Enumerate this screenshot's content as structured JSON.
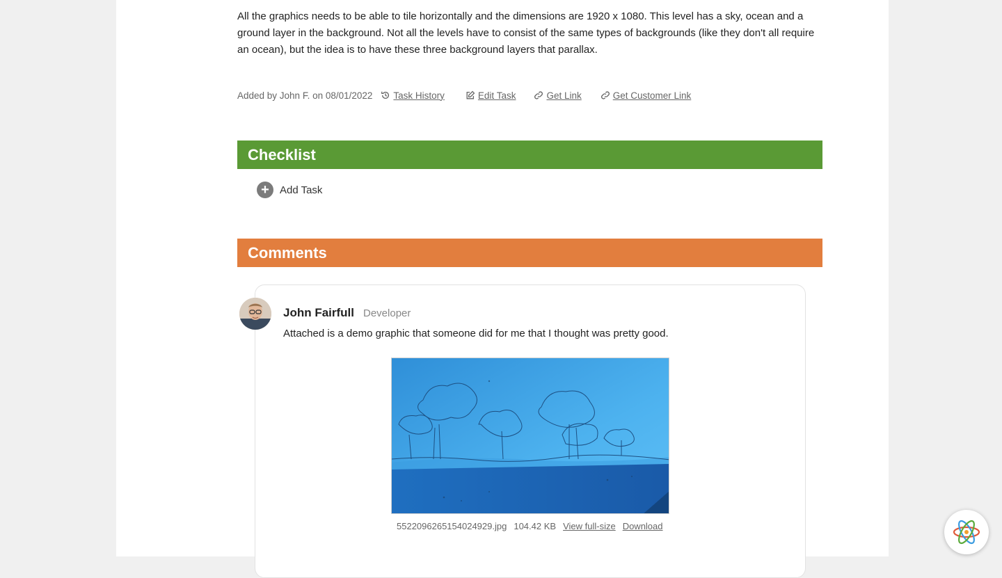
{
  "task": {
    "description": "All the graphics needs to be able to tile horizontally and the dimensions are 1920 x 1080. This level has a sky, ocean and a ground layer in the background. Not all the levels have to consist of the same types of backgrounds (like they don't all require an ocean), but the idea is to have these three background layers that parallax.",
    "added_by": "Added by John F. on 08/01/2022",
    "links": {
      "task_history": "Task History",
      "edit_task": "Edit Task",
      "get_link": "Get Link",
      "get_customer_link": "Get Customer Link"
    }
  },
  "checklist": {
    "title": "Checklist",
    "add_task_label": "Add Task"
  },
  "comments": {
    "title": "Comments",
    "items": [
      {
        "author": "John Fairfull",
        "role": "Developer",
        "text": "Attached is a demo graphic that someone did for me that I thought was pretty good.",
        "attachment": {
          "filename": "5522096265154024929.jpg",
          "size": "104.42 KB",
          "view_label": "View full-size",
          "download_label": "Download"
        }
      }
    ]
  },
  "colors": {
    "checklist_bar": "#5a9a35",
    "comments_bar": "#e27e3e",
    "page_bg": "#f0f0f0"
  },
  "icons": {
    "history": "history-icon",
    "edit": "edit-icon",
    "link": "link-icon",
    "add": "plus-circle-icon",
    "help": "atom-logo-icon"
  }
}
